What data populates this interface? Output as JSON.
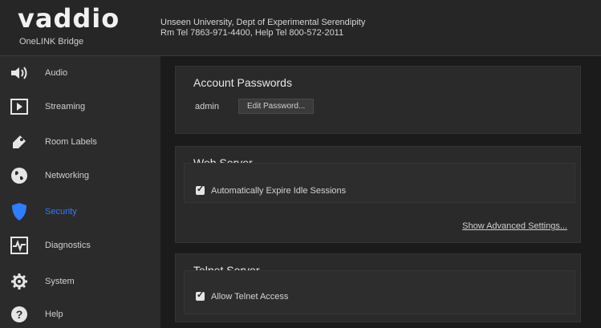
{
  "header": {
    "brand": "vaddio",
    "product": "OneLINK Bridge",
    "site_line1": "Unseen University, Dept of Experimental Serendipity",
    "site_line2": "Rm Tel 7863-971-4400, Help Tel 800-572-2011"
  },
  "sidebar": {
    "items": [
      {
        "label": "Audio",
        "icon": "speaker-icon"
      },
      {
        "label": "Streaming",
        "icon": "play-icon"
      },
      {
        "label": "Room Labels",
        "icon": "tag-icon"
      },
      {
        "label": "Networking",
        "icon": "globe-icon"
      },
      {
        "label": "Security",
        "icon": "shield-icon",
        "active": true
      },
      {
        "label": "Diagnostics",
        "icon": "pulse-icon"
      },
      {
        "label": "System",
        "icon": "gear-icon"
      },
      {
        "label": "Help",
        "icon": "help-icon"
      }
    ],
    "active_color": "#2f7cff"
  },
  "main": {
    "account": {
      "title": "Account Passwords",
      "user": "admin",
      "edit_button": "Edit Password..."
    },
    "web": {
      "title": "Web Server",
      "expire_label": "Automatically Expire Idle Sessions",
      "expire_checked": true,
      "advanced_link": "Show Advanced Settings..."
    },
    "telnet": {
      "title": "Telnet Server",
      "allow_label": "Allow Telnet Access",
      "allow_checked": true
    }
  }
}
